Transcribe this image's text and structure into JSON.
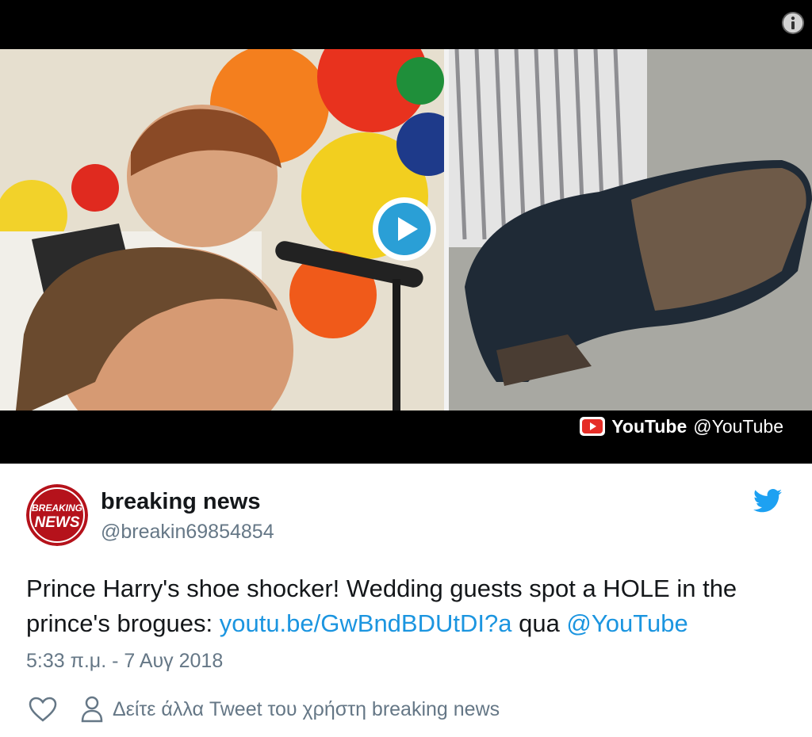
{
  "media": {
    "source_name": "YouTube",
    "source_handle": "@YouTube"
  },
  "tweet": {
    "display_name": "breaking news",
    "handle": "@breakin69854854",
    "avatar_text_line1": "BREAKING",
    "avatar_text_line2": "NEWS",
    "text_plain": "Prince Harry's shoe shocker! Wedding guests spot a HOLE in the prince's brogues: ",
    "text_link": "youtu.be/GwBndBDUtDI?a",
    "text_via": " qua ",
    "text_mention": "@YouTube",
    "timestamp": "5:33 π.μ. - 7 Αυγ 2018",
    "more_tweets_label": "Δείτε άλλα Tweet του χρήστη breaking news"
  },
  "colors": {
    "link": "#1b95e0",
    "twitter_blue": "#1da1f2",
    "muted": "#657786",
    "text": "#14171a"
  },
  "icons": [
    "info-icon",
    "play-icon",
    "youtube-logo-icon",
    "twitter-bird-icon",
    "heart-icon",
    "person-icon"
  ]
}
